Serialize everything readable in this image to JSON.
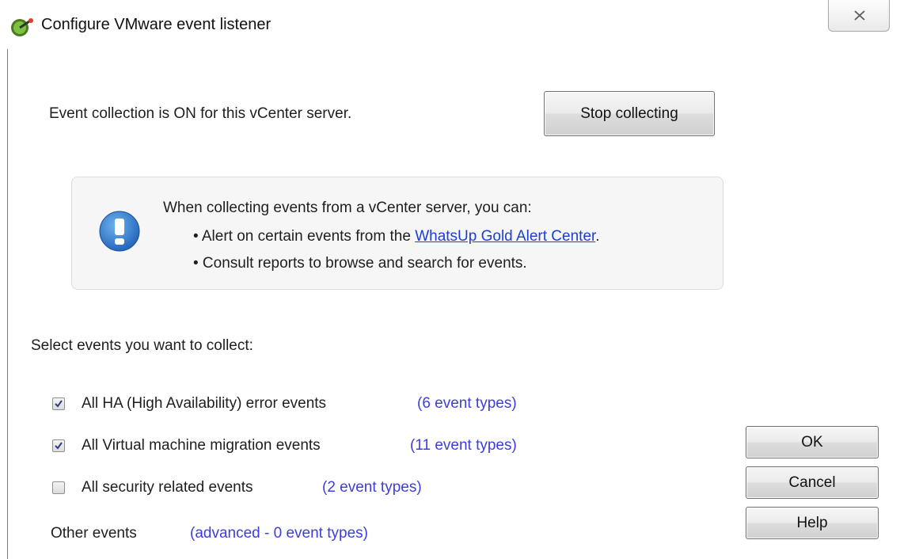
{
  "window": {
    "title": "Configure VMware event listener"
  },
  "collection": {
    "status_text": "Event collection is ON for this vCenter server.",
    "stop_button": "Stop collecting"
  },
  "info": {
    "line1": "When collecting events from a vCenter server, you can:",
    "bullet1_prefix": "• Alert on certain events from the ",
    "bullet1_link": "WhatsUp Gold Alert Center",
    "bullet1_suffix": ".",
    "bullet2": "• Consult reports to browse and search for events."
  },
  "events": {
    "heading": "Select events you want to collect:",
    "options": [
      {
        "label": "All HA (High Availability) error events",
        "count": "(6 event types)",
        "checked": true
      },
      {
        "label": "All Virtual machine migration events",
        "count": "(11 event types)",
        "checked": true
      },
      {
        "label": "All security related events",
        "count": "(2 event types)",
        "checked": false
      }
    ],
    "other_label": "Other events",
    "other_link": "(advanced - 0 event types)"
  },
  "buttons": {
    "ok": "OK",
    "cancel": "Cancel",
    "help": "Help"
  },
  "icons": {
    "title": "vmware-app-icon",
    "info": "exclamation-info-icon",
    "close": "close-icon"
  },
  "colors": {
    "link": "#1a3fd6",
    "count": "#3d3de0",
    "info_icon": "#2f7fd0"
  }
}
